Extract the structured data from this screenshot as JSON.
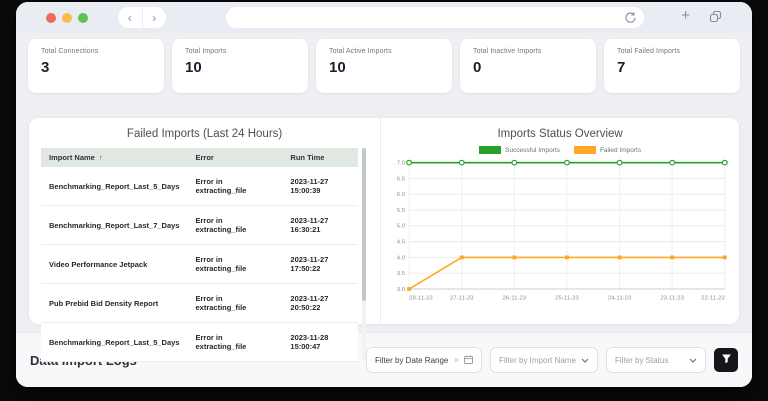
{
  "browser": {
    "back_icon": "‹",
    "forward_icon": "›",
    "plus_icon": "+",
    "url_value": ""
  },
  "stats_cards": [
    {
      "label": "Total Connections",
      "value": "3"
    },
    {
      "label": "Total Imports",
      "value": "10"
    },
    {
      "label": "Total Active Imports",
      "value": "10"
    },
    {
      "label": "Total Inactive Imports",
      "value": "0"
    },
    {
      "label": "Total Failed Imports",
      "value": "7"
    }
  ],
  "failed_imports": {
    "title": "Failed Imports (Last 24 Hours)",
    "columns": {
      "name": "Import Name",
      "error": "Error",
      "run_time": "Run Time"
    },
    "sort_icon": "↑",
    "rows": [
      {
        "name": "Benchmarking_Report_Last_5_Days",
        "error": "Error in extracting_file",
        "run_time": "2023-11-27 15:00:39"
      },
      {
        "name": "Benchmarking_Report_Last_7_Days",
        "error": "Error in extracting_file",
        "run_time": "2023-11-27 16:30:21"
      },
      {
        "name": "Video Performance Jetpack",
        "error": "Error in extracting_file",
        "run_time": "2023-11-27 17:50:22"
      },
      {
        "name": "Pub Prebid Bid Density Report",
        "error": "Error in extracting_file",
        "run_time": "2023-11-27 20:50:22"
      },
      {
        "name": "Benchmarking_Report_Last_5_Days",
        "error": "Error in extracting_file",
        "run_time": "2023-11-28 15:00:47"
      }
    ]
  },
  "chart_data": {
    "type": "line",
    "title": "Imports Status Overview",
    "categories": [
      "28-11-23",
      "27-11-23",
      "26-11-23",
      "25-11-23",
      "24-11-23",
      "23-11-23",
      "22-11-23"
    ],
    "series": [
      {
        "name": "Successful Imports",
        "color": "#2aa02a",
        "marker": "circle-open",
        "values": [
          7,
          7,
          7,
          7,
          7,
          7,
          7
        ]
      },
      {
        "name": "Failed Imports",
        "color": "#ffa726",
        "marker": "square",
        "values": [
          3,
          4,
          4,
          4,
          4,
          4,
          4
        ]
      }
    ],
    "ylim": [
      3.0,
      7.0
    ],
    "y_step": 0.5,
    "y_tick_labels": [
      "3.0",
      "3.5",
      "4.0",
      "4.5",
      "5.0",
      "5.5",
      "6.0",
      "6.5",
      "7.0"
    ],
    "grid": true,
    "legend_position": "top"
  },
  "footer": {
    "title": "Data Import Logs",
    "date_filter": {
      "value": "Filter by Date Range",
      "clear_icon": "×"
    },
    "import_filter": {
      "placeholder": "Filter by Import Name"
    },
    "status_filter": {
      "placeholder": "Filter by Status"
    }
  },
  "colors": {
    "successful": "#2aa02a",
    "failed": "#ffa726",
    "table_header_bg": "#e0e8e1",
    "chrome_bg": "#e9ecf2",
    "traffic_red": "#ee6a5f",
    "traffic_yellow": "#f5bd4b",
    "traffic_green": "#5fc454",
    "filter_button_bg": "#141619"
  }
}
